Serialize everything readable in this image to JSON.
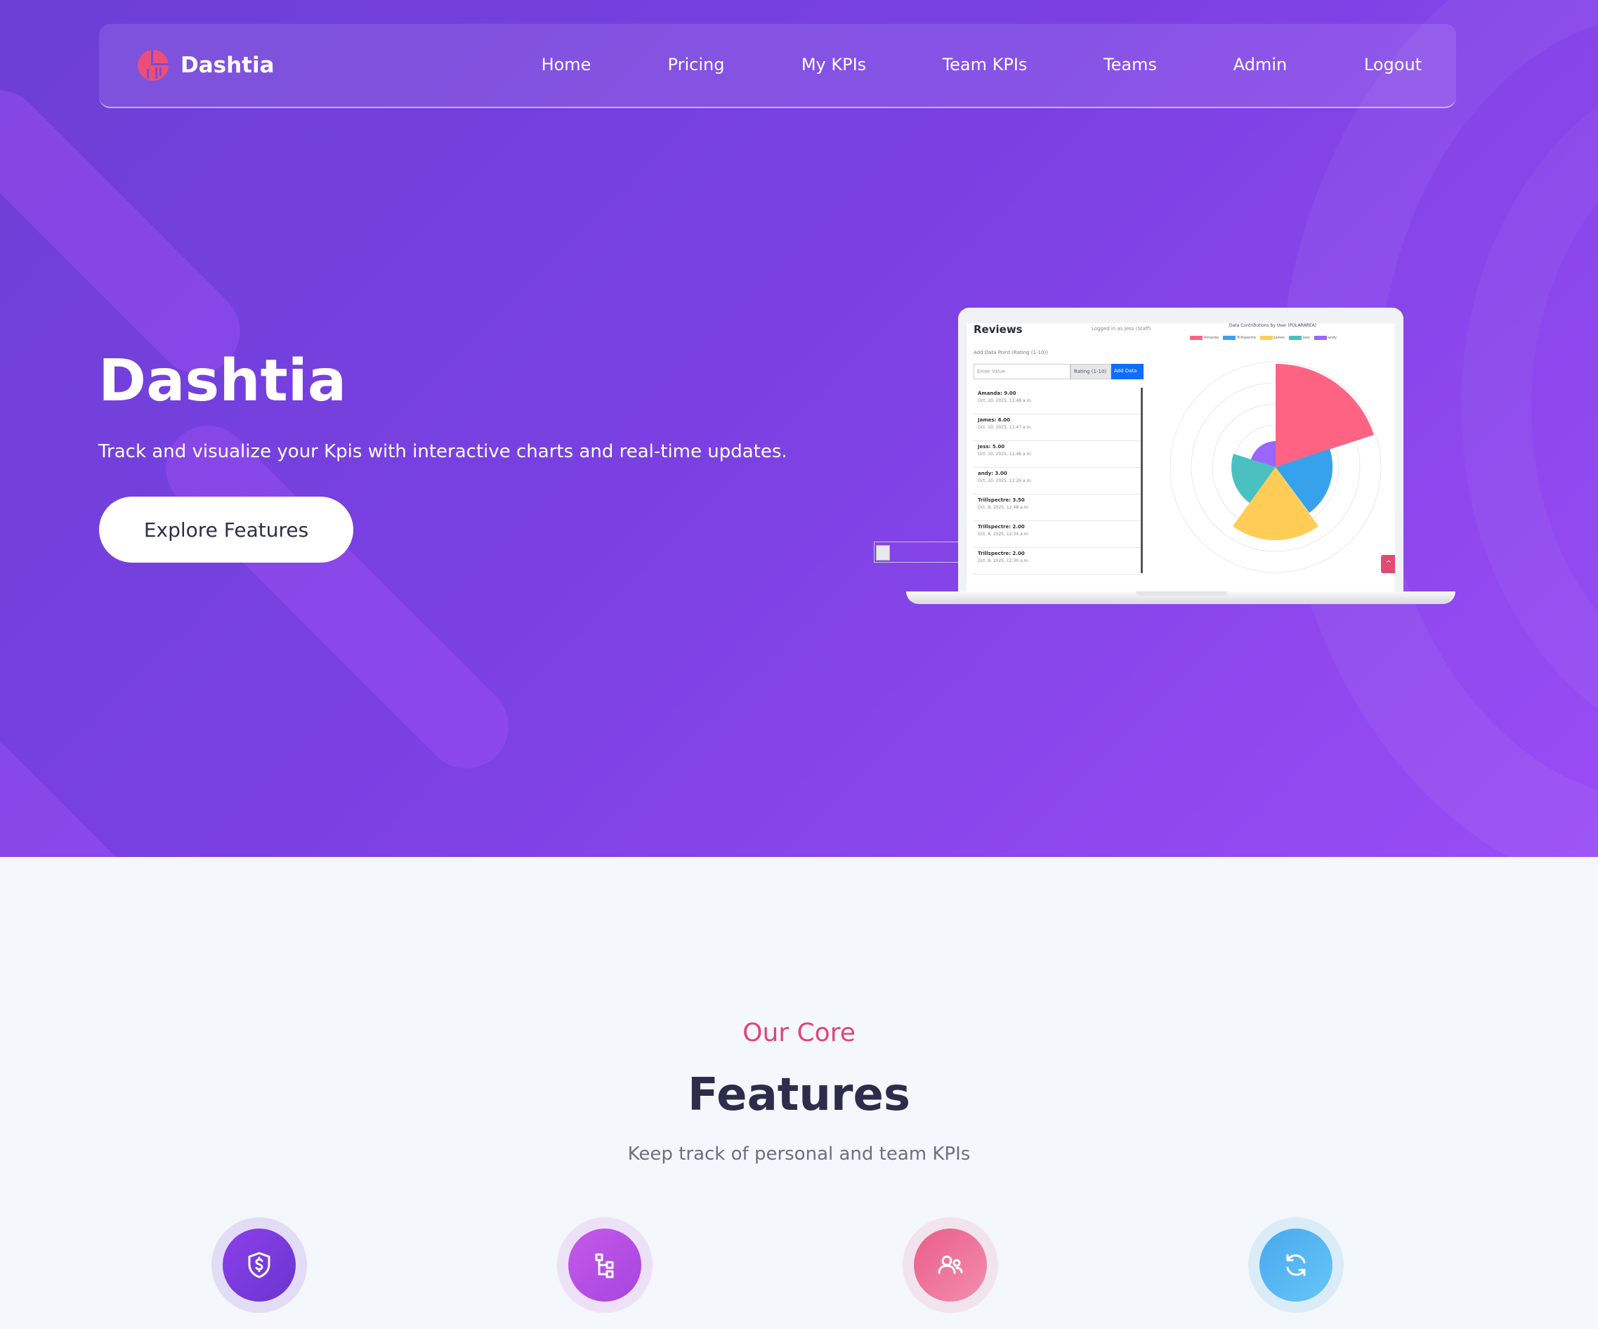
{
  "brand": {
    "name": "Dashtia"
  },
  "nav": {
    "items": [
      "Home",
      "Pricing",
      "My KPIs",
      "Team KPIs",
      "Teams",
      "Admin",
      "Logout"
    ]
  },
  "hero": {
    "title": "Dashtia",
    "subtitle": "Track and visualize your Kpis with interactive charts and real-time updates.",
    "cta_label": "Explore Features"
  },
  "preview": {
    "title": "Reviews",
    "logged_in": "Logged in as Jess (Staff)",
    "add_label": "Add Data Point (Rating (1-10))",
    "input_placeholder": "Enter Value",
    "select_value": "Rating (1-10)",
    "add_button": "Add Data",
    "entries": [
      {
        "name": "Amanda: 9.00",
        "date": "Oct. 10, 2025, 11:48 a.m."
      },
      {
        "name": "James: 6.00",
        "date": "Oct. 10, 2025, 11:47 a.m."
      },
      {
        "name": "Jess: 5.00",
        "date": "Oct. 10, 2025, 11:46 a.m."
      },
      {
        "name": "andy: 3.00",
        "date": "Oct. 10, 2025, 11:26 a.m."
      },
      {
        "name": "Trillspectre: 3.50",
        "date": "Oct. 8, 2025, 12:48 a.m."
      },
      {
        "name": "Trillspectre: 2.00",
        "date": "Oct. 8, 2025, 12:34 a.m."
      },
      {
        "name": "Trillspectre: 2.00",
        "date": "Oct. 8, 2025, 12:30 a.m."
      }
    ],
    "chart_title": "Data Contributions by User (POLARAREA)",
    "legend": [
      {
        "name": "Amanda",
        "color": "#ff6384"
      },
      {
        "name": "Trillspectre",
        "color": "#36a2eb"
      },
      {
        "name": "James",
        "color": "#ffcd56"
      },
      {
        "name": "Jess",
        "color": "#4bc0c0"
      },
      {
        "name": "andy",
        "color": "#9966ff"
      }
    ],
    "scroll_up_icon": "chevron-up-icon"
  },
  "features": {
    "label": "Our Core",
    "title": "Features",
    "subtitle": "Keep track of personal and team KPIs",
    "icons": [
      {
        "name": "shield-dollar-icon",
        "gradient": [
          "#8b3fe8",
          "#6a35d0"
        ]
      },
      {
        "name": "hierarchy-icon",
        "gradient": [
          "#c35be8",
          "#a844e0"
        ]
      },
      {
        "name": "users-icon",
        "gradient": [
          "#ea5d8a",
          "#f28fae"
        ]
      },
      {
        "name": "refresh-icon",
        "gradient": [
          "#4aa9ef",
          "#66c6f7"
        ]
      }
    ]
  },
  "colors": {
    "hero_gradient": [
      "#6d3fd6",
      "#9a4cf5"
    ],
    "accent_pink": "#e0457b",
    "dark_text": "#2b2d4a"
  }
}
